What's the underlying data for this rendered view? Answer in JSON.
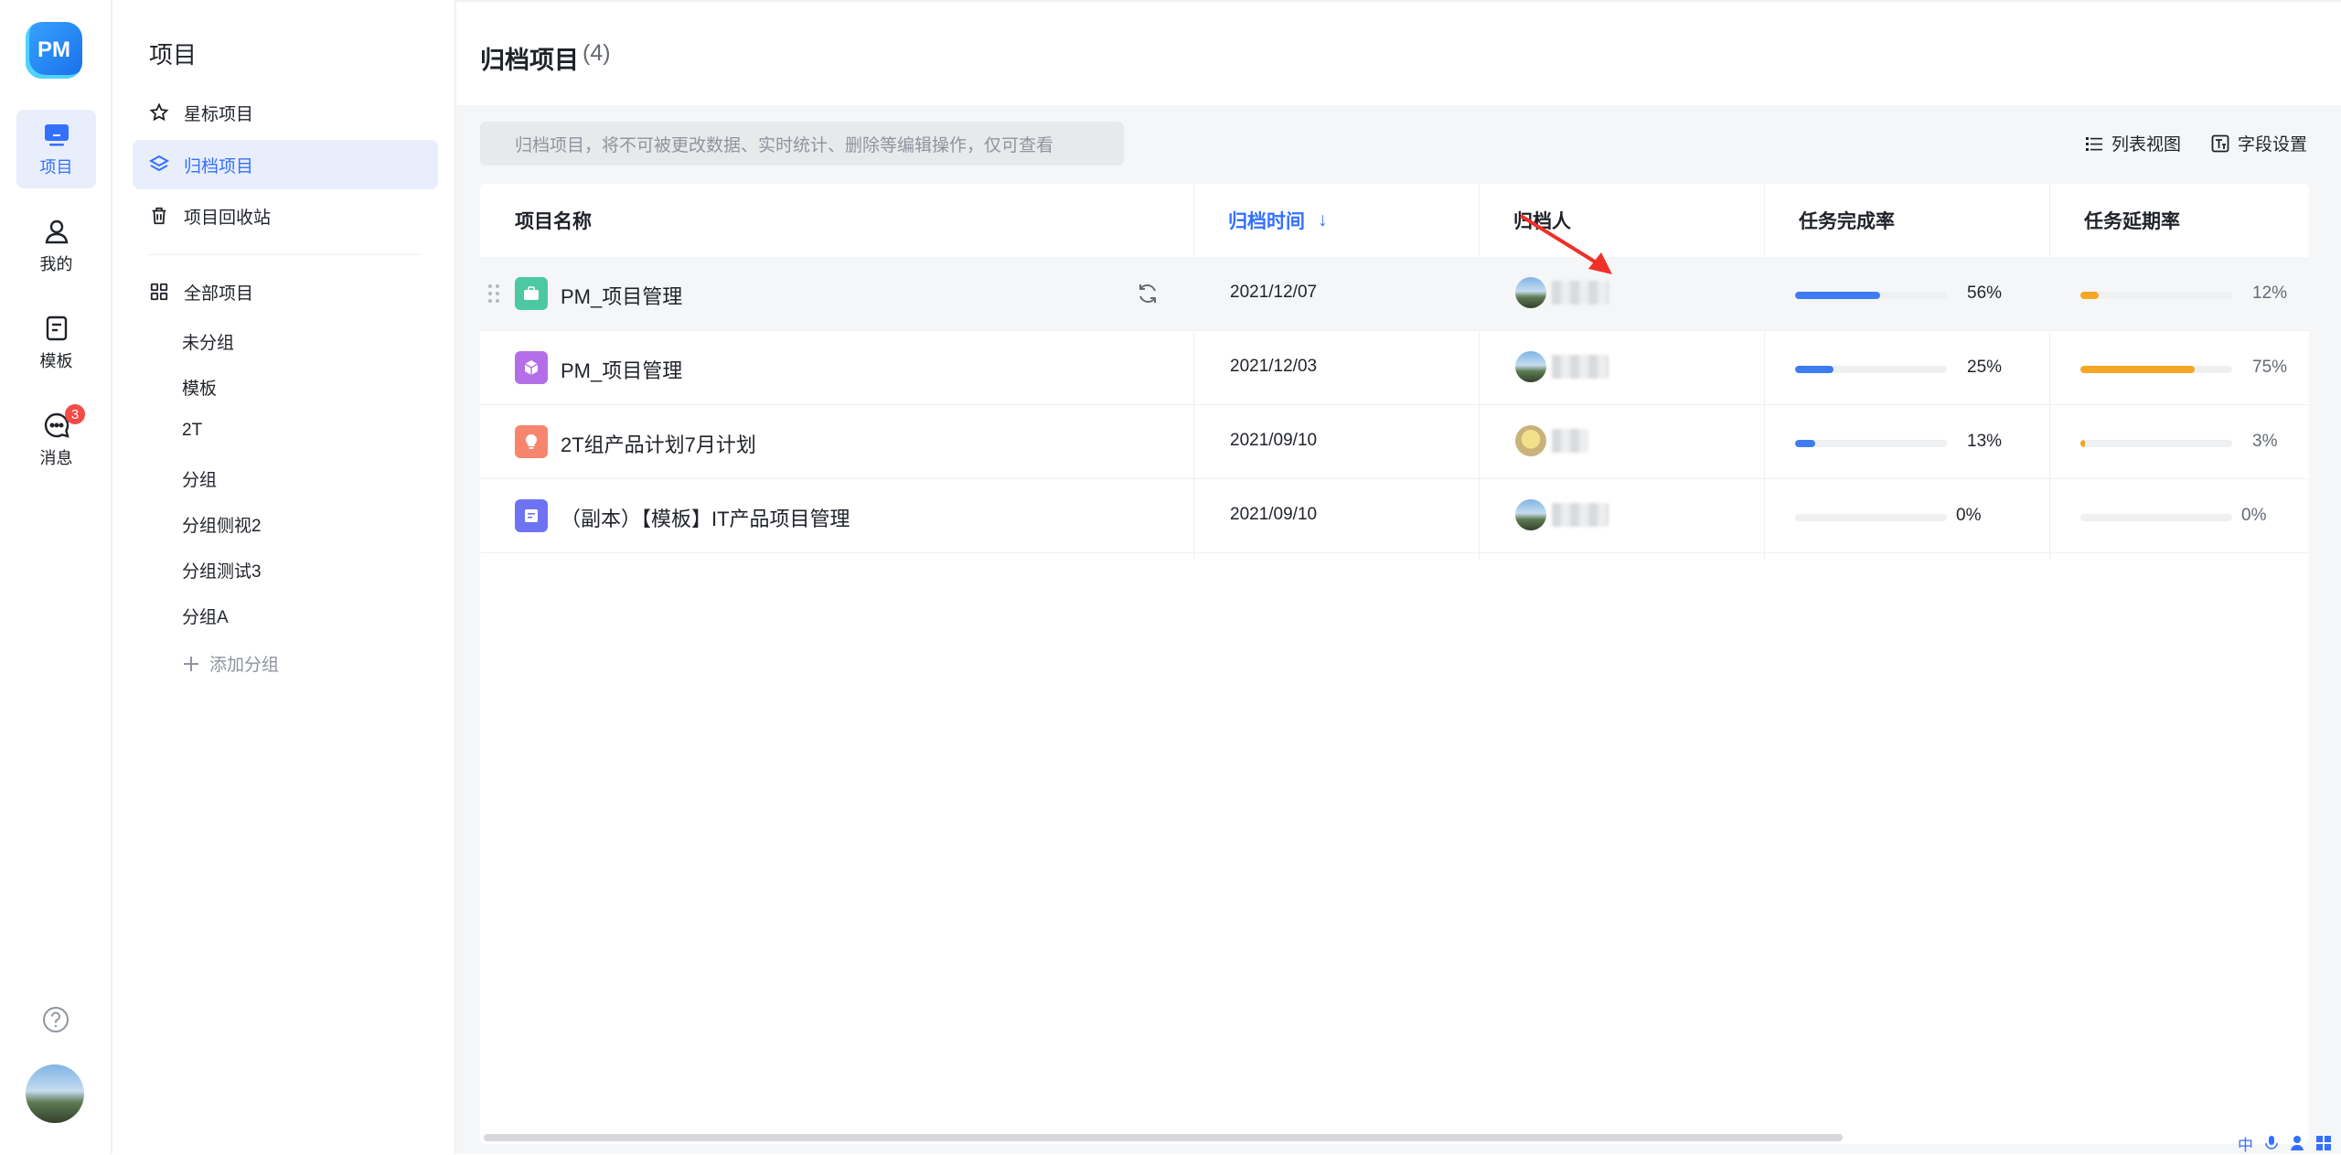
{
  "rail": {
    "logo": "PM",
    "items": [
      {
        "label": "项目",
        "icon": "monitor-icon",
        "active": true
      },
      {
        "label": "我的",
        "icon": "user-icon",
        "active": false
      },
      {
        "label": "模板",
        "icon": "template-icon",
        "active": false
      },
      {
        "label": "消息",
        "icon": "message-icon",
        "active": false,
        "badge": "3"
      }
    ]
  },
  "sidebar": {
    "title": "项目",
    "items": [
      {
        "label": "星标项目",
        "icon": "star-icon"
      },
      {
        "label": "归档项目",
        "icon": "layers-icon",
        "active": true
      },
      {
        "label": "项目回收站",
        "icon": "trash-icon"
      }
    ],
    "all_projects": "全部项目",
    "groups": [
      "未分组",
      "模板",
      "2T",
      "分组",
      "分组侧视2",
      "分组测试3",
      "分组A"
    ],
    "add_group": "添加分组"
  },
  "header": {
    "title": "归档项目",
    "count": "(4)"
  },
  "notice": "归档项目，将不可被更改数据、实时统计、删除等编辑操作，仅可查看",
  "toolbar": {
    "list_view": "列表视图",
    "field_settings": "字段设置"
  },
  "table": {
    "columns": [
      "项目名称",
      "归档时间",
      "归档人",
      "任务完成率",
      "任务延期率"
    ],
    "sort_indicator": "↓",
    "rows": [
      {
        "name": "PM_项目管理",
        "icon_color": "#4cc9a0",
        "date": "2021/12/07",
        "complete": 56,
        "complete_label": "56%",
        "delay": 12,
        "delay_label": "12%"
      },
      {
        "name": "PM_项目管理",
        "icon_color": "#b36ee8",
        "date": "2021/12/03",
        "complete": 25,
        "complete_label": "25%",
        "delay": 75,
        "delay_label": "75%"
      },
      {
        "name": "2T组产品计划7月计划",
        "icon_color": "#f7856e",
        "date": "2021/09/10",
        "complete": 13,
        "complete_label": "13%",
        "delay": 3,
        "delay_label": "3%"
      },
      {
        "name": "（副本）【模板】IT产品项目管理",
        "icon_color": "#6e73f2",
        "date": "2021/09/10",
        "complete": 0,
        "complete_label": "0%",
        "delay": 0,
        "delay_label": "0%"
      }
    ]
  },
  "colors": {
    "accent": "#3370ff",
    "complete_bar": "#3d7cf2",
    "delay_bar": "#f5a623"
  },
  "ime": {
    "lang": "中"
  }
}
